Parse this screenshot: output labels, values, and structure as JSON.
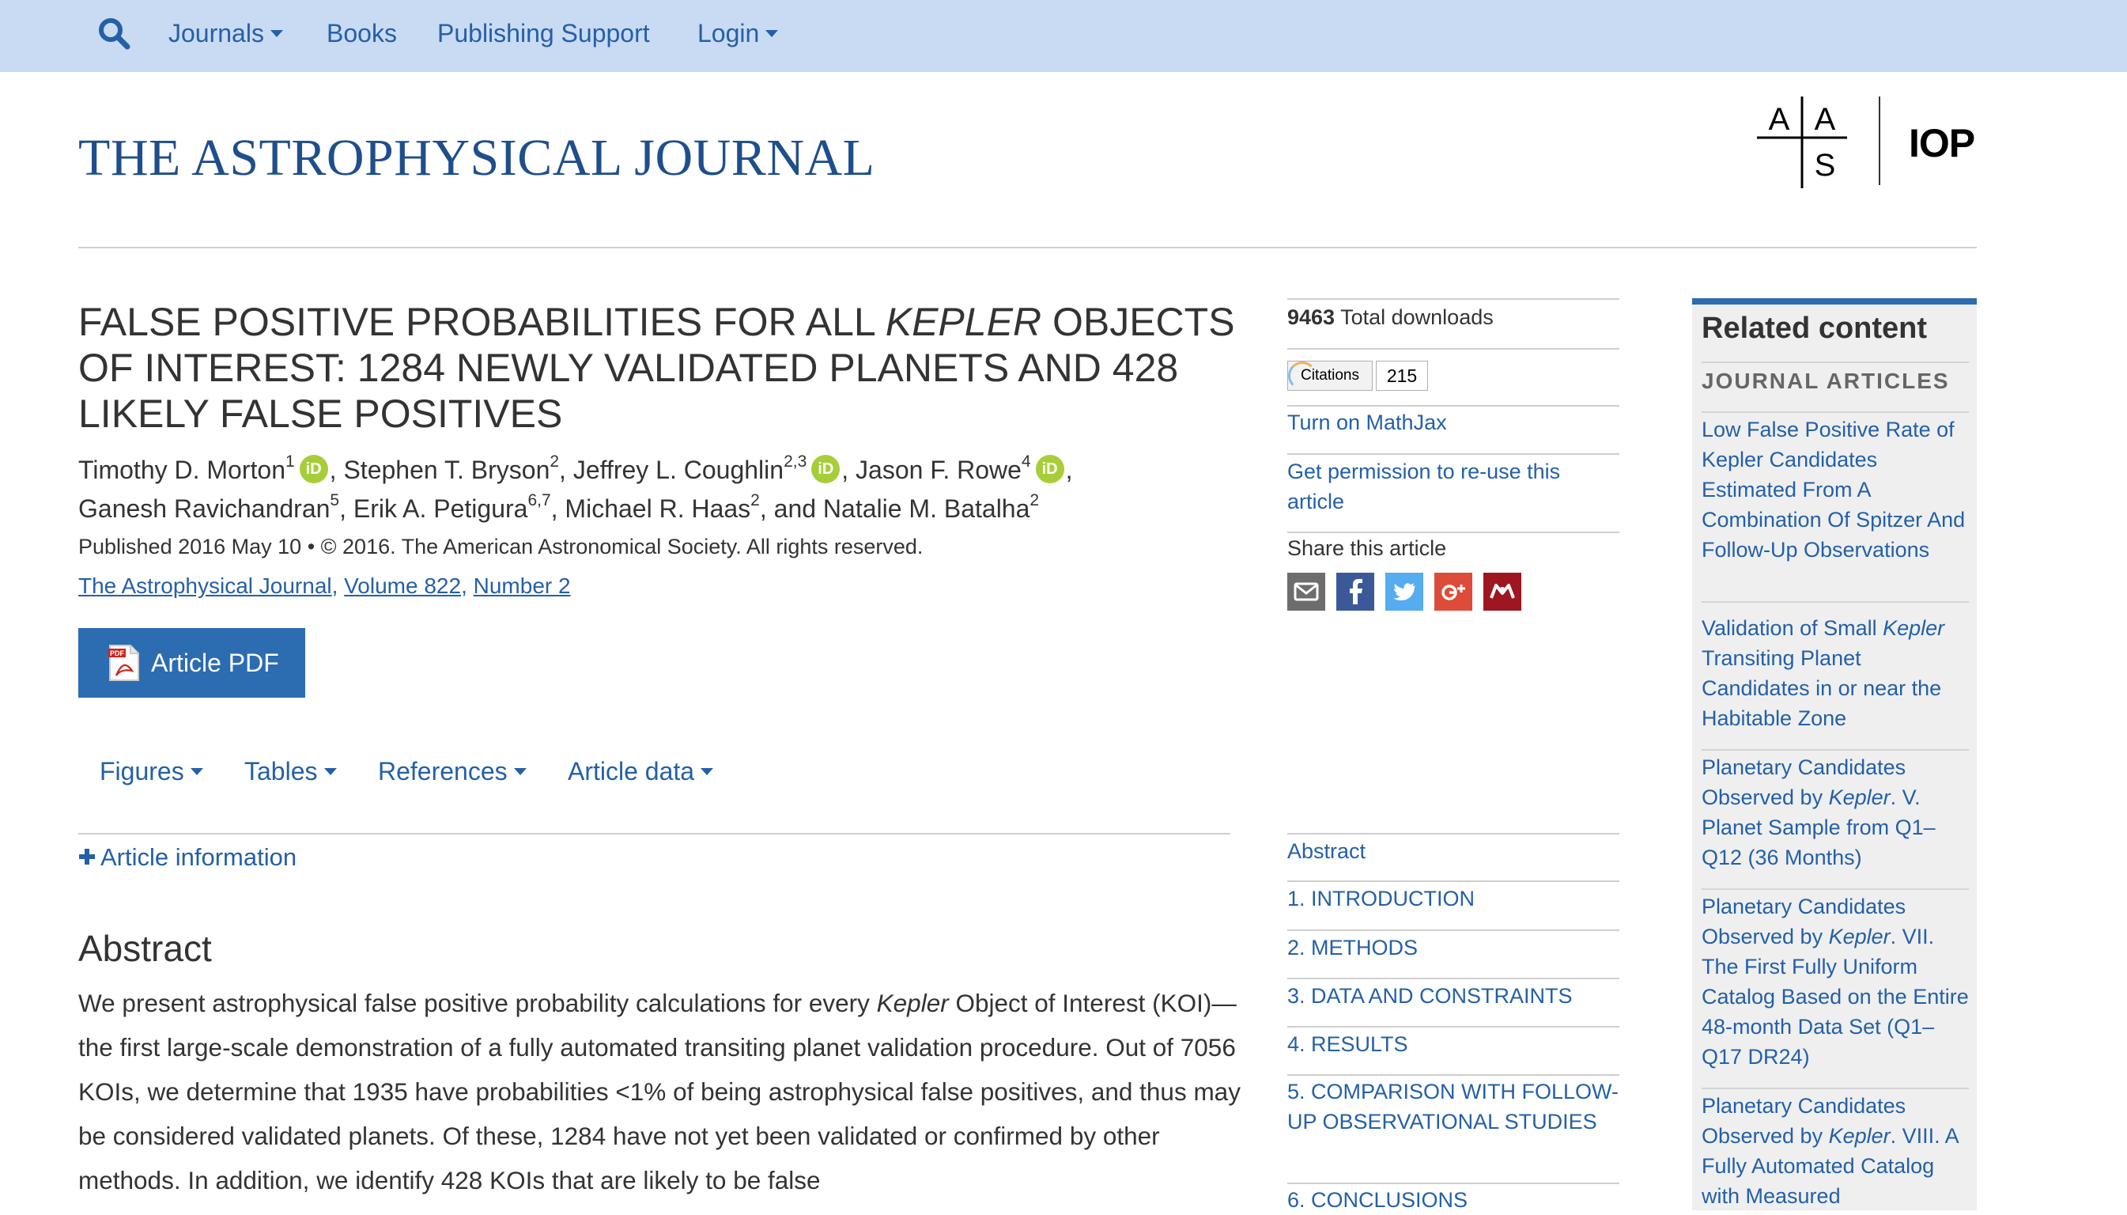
{
  "nav": {
    "journals": "Journals",
    "books": "Books",
    "publishing_support": "Publishing Support",
    "login": "Login"
  },
  "header": {
    "journal_title": "THE ASTROPHYSICAL JOURNAL",
    "aas_logo_letters": [
      "A",
      "A",
      "S"
    ],
    "iop_logo": "IOP"
  },
  "article": {
    "title_part1": "FALSE POSITIVE PROBABILITIES FOR ALL ",
    "title_italic": "KEPLER",
    "title_part2": " OBJECTS OF INTEREST: 1284 NEWLY VALIDATED PLANETS AND 428 LIKELY FALSE POSITIVES",
    "authors": [
      {
        "name": "Timothy D. Morton",
        "sup": "1",
        "orcid": true
      },
      {
        "name": "Stephen T. Bryson",
        "sup": "2",
        "orcid": false
      },
      {
        "name": "Jeffrey L. Coughlin",
        "sup": "2,3",
        "orcid": true
      },
      {
        "name": "Jason F. Rowe",
        "sup": "4",
        "orcid": true
      },
      {
        "name": "Ganesh Ravichandran",
        "sup": "5",
        "orcid": false
      },
      {
        "name": "Erik A. Petigura",
        "sup": "6,7",
        "orcid": false
      },
      {
        "name": "Michael R. Haas",
        "sup": "2",
        "orcid": false
      },
      {
        "name": "Natalie M. Batalha",
        "sup": "2",
        "orcid": false
      }
    ],
    "orcid_label": "iD",
    "and_word": "and",
    "published": "Published 2016 May 10 • © 2016. The American Astronomical Society. All rights reserved.",
    "journal_link": "The Astrophysical Journal",
    "volume_link": "Volume 822",
    "number_link": "Number 2",
    "pdf_icon_label": "PDF",
    "pdf_button": "Article PDF",
    "tabs": [
      "Figures",
      "Tables",
      "References",
      "Article data"
    ],
    "article_info": "Article information",
    "abstract_heading": "Abstract",
    "abstract_before_italic": "We present astrophysical false positive probability calculations for every ",
    "abstract_italic": "Kepler",
    "abstract_after_italic": " Object of Interest (KOI)—the first large-scale demonstration of a fully automated transiting planet validation procedure. Out of 7056 KOIs, we determine that 1935 have probabilities <1% of being astrophysical false positives, and thus may be considered validated planets. Of these, 1284 have not yet been validated or confirmed by other methods. In addition, we identify 428 KOIs that are likely to be false"
  },
  "metrics": {
    "downloads_count": "9463",
    "downloads_label": "Total downloads",
    "citations_label": "Citations",
    "citations_count": "215",
    "mathjax": "Turn on MathJax",
    "permission": "Get permission to re-use this article",
    "share": "Share this article",
    "share_buttons": [
      "email",
      "facebook",
      "twitter",
      "google-plus",
      "mendeley"
    ]
  },
  "toc": [
    "Abstract",
    "1. INTRODUCTION",
    "2. METHODS",
    "3. DATA AND CONSTRAINTS",
    "4. RESULTS",
    "5. COMPARISON WITH FOLLOW-UP OBSERVATIONAL STUDIES",
    "6. CONCLUSIONS"
  ],
  "related": {
    "heading": "Related content",
    "subheading": "JOURNAL ARTICLES",
    "items": [
      {
        "before": "Low False Positive Rate of Kepler Candidates Estimated From A Combination Of Spitzer And Follow-Up Observations",
        "italic": "",
        "after": ""
      },
      {
        "before": "Validation of Small ",
        "italic": "Kepler",
        "after": " Transiting Planet Candidates in or near the Habitable Zone"
      },
      {
        "before": "Planetary Candidates Observed by ",
        "italic": "Kepler",
        "after": ". V. Planet Sample from Q1–Q12 (36 Months)"
      },
      {
        "before": "Planetary Candidates Observed by ",
        "italic": "Kepler",
        "after": ". VII. The First Fully Uniform Catalog Based on the Entire 48-month Data Set (Q1–Q17 DR24)"
      },
      {
        "before": "Planetary Candidates Observed by ",
        "italic": "Kepler",
        "after": ". VIII. A Fully Automated Catalog with Measured"
      }
    ]
  }
}
